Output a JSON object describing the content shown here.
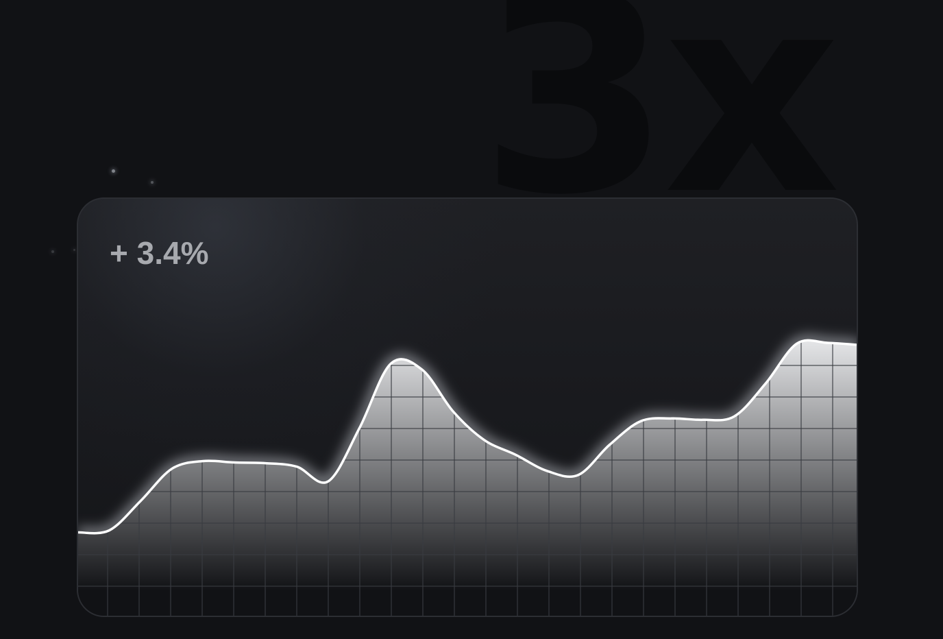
{
  "background_text": "3x",
  "chart_data": {
    "type": "area",
    "title": "",
    "xlabel": "",
    "ylabel": "",
    "annotation": "+ 3.4%",
    "grid": true,
    "x": [
      0,
      0.5,
      1,
      1.5,
      2,
      2.5,
      3,
      3.5,
      4,
      4.5,
      5,
      5.5,
      6,
      6.5,
      7,
      7.5,
      8,
      8.5,
      9,
      9.5,
      10,
      10.5,
      11,
      11.5,
      12,
      12.5
    ],
    "series": [
      {
        "values": [
          52.3,
          52.6,
          56.8,
          61.4,
          62.5,
          62.3,
          62.2,
          61.7,
          59.6,
          67.2,
          76.4,
          75.6,
          69.6,
          65.5,
          63.4,
          61.1,
          60.5,
          64.8,
          68.2,
          68.6,
          68.4,
          68.9,
          73.6,
          79.3,
          79.4,
          79.1
        ]
      }
    ],
    "ylim": [
      40,
      100
    ],
    "colors": {
      "line": "#ffffff",
      "fill_top": "#f2f3f5",
      "fill_bottom": "#111215",
      "grid": "#3a3c42",
      "card_border": "#2c2e33"
    }
  }
}
